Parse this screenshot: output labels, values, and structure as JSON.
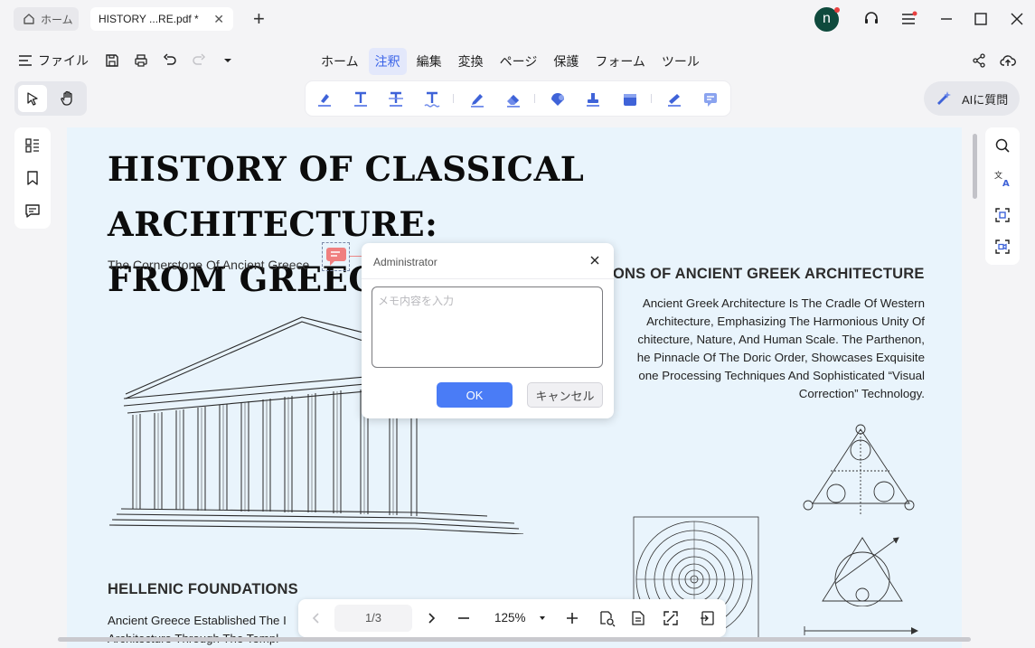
{
  "titlebar": {
    "home_tab": "ホーム",
    "doc_tab": "HISTORY ...RE.pdf *",
    "avatar_initial": "n"
  },
  "menu": {
    "file_label": "ファイル",
    "tabs": [
      "ホーム",
      "注釈",
      "編集",
      "変換",
      "ページ",
      "保護",
      "フォーム",
      "ツール"
    ],
    "active_tab": "注釈"
  },
  "ai_button_label": "AIに質問",
  "document": {
    "title_line1": "HISTORY OF CLASSICAL  ARCHITECTURE:",
    "title_line2": "FROM GREECE TO ROME",
    "subtitle": "The Cornerstone Of Ancient Greece",
    "section1_heading": "ONS OF ANCIENT GREEK ARCHITECTURE",
    "section1_lines": [
      "Ancient Greek Architecture Is The Cradle Of Western",
      "Architecture, Emphasizing The Harmonious Unity Of",
      "chitecture, Nature, And Human Scale. The Parthenon,",
      "he Pinnacle Of The Doric Order, Showcases Exquisite",
      "one Processing Techniques And Sophisticated “Visual",
      "Correction” Technology."
    ],
    "section2_heading": "HELLENIC FOUNDATIONS",
    "section2_lines": [
      "Ancient Greece Established The I",
      "Architecture Through The Templ"
    ]
  },
  "note_popup": {
    "author": "Administrator",
    "placeholder": "メモ内容を入力",
    "ok_label": "OK",
    "cancel_label": "キャンセル"
  },
  "bottom_nav": {
    "page_indicator": "1/3",
    "zoom": "125%"
  },
  "colors": {
    "accent": "#4a7cf6",
    "active_tab_text": "#3a63e8",
    "page_bg": "#e9f4fc",
    "note_marker": "#f07f7f",
    "avatar_bg": "#0f4a3d"
  }
}
